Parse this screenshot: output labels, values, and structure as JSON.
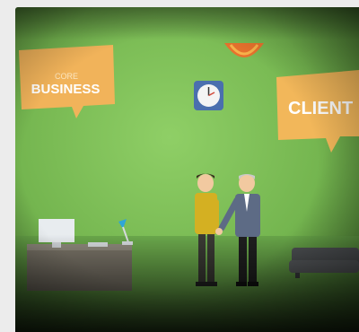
{
  "signs": {
    "left_small": "CORE",
    "left_big": "BUSINESS",
    "right_big": "CLIENT"
  },
  "colors": {
    "wall": "#7ec25a",
    "sign": "#f2b75a",
    "floor": "#6aa84f"
  }
}
